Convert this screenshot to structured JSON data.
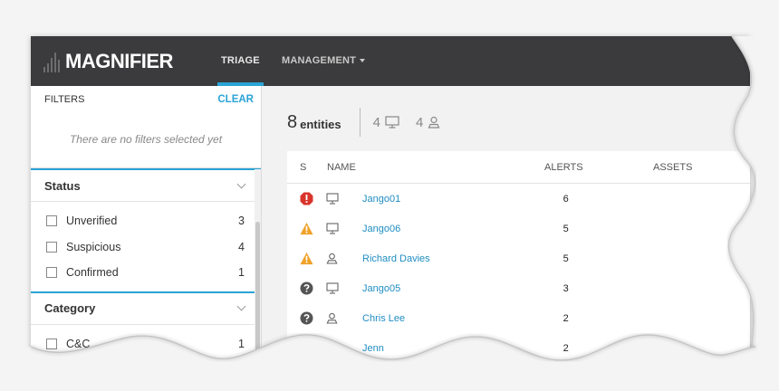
{
  "app": {
    "logo_text": "MAGNIFIER"
  },
  "nav": {
    "tabs": [
      {
        "label": "TRIAGE",
        "active": true
      },
      {
        "label": "MANAGEMENT",
        "active": false
      }
    ]
  },
  "filters": {
    "title": "FILTERS",
    "clear_label": "CLEAR",
    "empty_text": "There are no filters selected yet",
    "groups": [
      {
        "name": "Status",
        "items": [
          {
            "label": "Unverified",
            "count": "3"
          },
          {
            "label": "Suspicious",
            "count": "4"
          },
          {
            "label": "Confirmed",
            "count": "1"
          }
        ]
      },
      {
        "name": "Category",
        "items": [
          {
            "label": "C&C",
            "count": "1"
          }
        ]
      }
    ]
  },
  "summary": {
    "entity_count": "8",
    "entity_label": "entities",
    "asset_count": "4",
    "asset_icon": "monitor-icon",
    "user_count": "4",
    "user_icon": "user-icon"
  },
  "table": {
    "headers": {
      "s": "S",
      "name": "NAME",
      "alerts": "ALERTS",
      "assets": "ASSETS"
    },
    "rows": [
      {
        "severity": "critical",
        "type": "monitor-icon",
        "name": "Jango01",
        "alerts": "6"
      },
      {
        "severity": "warning",
        "type": "monitor-icon",
        "name": "Jango06",
        "alerts": "5"
      },
      {
        "severity": "warning",
        "type": "user-icon",
        "name": "Richard Davies",
        "alerts": "5"
      },
      {
        "severity": "unknown",
        "type": "monitor-icon",
        "name": "Jango05",
        "alerts": "3"
      },
      {
        "severity": "unknown",
        "type": "user-icon",
        "name": "Chris Lee",
        "alerts": "2"
      },
      {
        "severity": "unknown",
        "type": "user-icon",
        "name": "Jenn",
        "alerts": "2"
      }
    ]
  },
  "colors": {
    "accent": "#2aa3d6",
    "topbar": "#3b3b3d",
    "critical": "#d9342b",
    "warning": "#f0a128",
    "unknown": "#555555",
    "link": "#1f8dc2"
  }
}
